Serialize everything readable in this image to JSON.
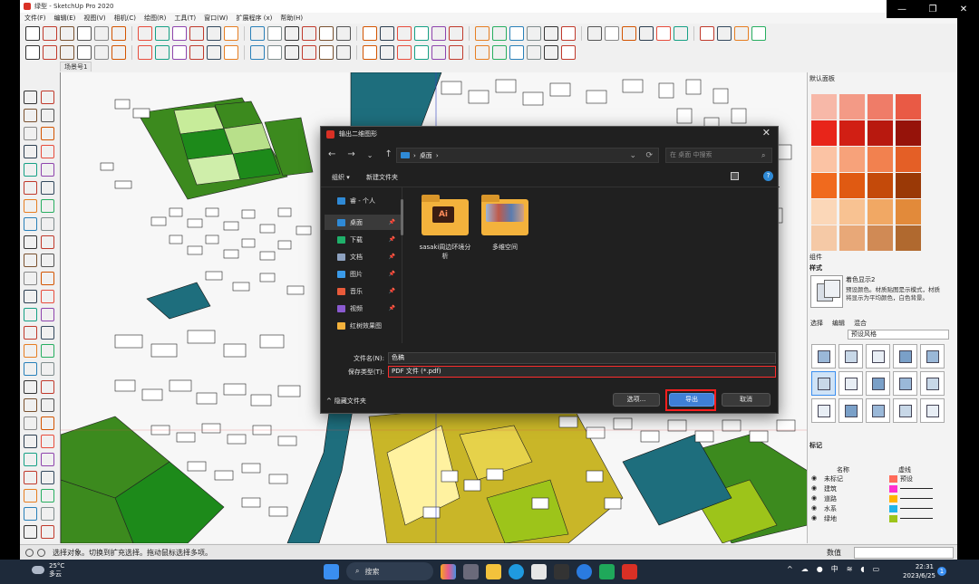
{
  "app": {
    "title": "绿型 - SketchUp Pro 2020",
    "scene_tab": "场景号1",
    "window_controls": [
      "minimize-icon",
      "maximize-icon",
      "close-icon"
    ]
  },
  "menu": [
    "文件(F)",
    "编辑(E)",
    "视图(V)",
    "相机(C)",
    "绘图(R)",
    "工具(T)",
    "窗口(W)",
    "扩展程序 (x)",
    "帮助(H)"
  ],
  "status": {
    "text": "选择对象。切换到扩充选择。拖动鼠标选择多项。",
    "value_label": "数值"
  },
  "right_panel": {
    "tray_title": "默认面板",
    "components_label": "组件",
    "styles_label": "样式",
    "style_name": "着色显示2",
    "style_desc": "预设颜色。材质贴图是示模式，材质将显示为平均颜色，白色背景。",
    "style_tabs": [
      "选择",
      "编辑",
      "混合"
    ],
    "style_dropdown": "预设风格",
    "tags_label": "标记",
    "tags_header": [
      "名称",
      "虚线"
    ],
    "tags": [
      {
        "name": "未标记",
        "color": "#ff6a5a",
        "dash": "预设"
      },
      {
        "name": "建筑",
        "color": "#ff2fd0",
        "dash": ""
      },
      {
        "name": "道路",
        "color": "#ffb400",
        "dash": ""
      },
      {
        "name": "水系",
        "color": "#1fb4e8",
        "dash": ""
      },
      {
        "name": "绿地",
        "color": "#9dc41a",
        "dash": ""
      }
    ],
    "swatch_colors": [
      "#f7b8a8",
      "#f39a86",
      "#ef7c68",
      "#e95a45",
      "#e8251a",
      "#d11f14",
      "#b8190f",
      "#96130a",
      "#fbc3a4",
      "#f7a27a",
      "#f2814f",
      "#e45f26",
      "#f06a1e",
      "#e05a12",
      "#c44a0a",
      "#9a3906",
      "#fbd7b8",
      "#f8c292",
      "#f1a864",
      "#e28a3a",
      "#f5c9a6",
      "#e8a878",
      "#d08a55",
      "#b0692f"
    ]
  },
  "dialog": {
    "title": "输出二维图形",
    "breadcrumb_sep": "›",
    "location": "桌面",
    "search_placeholder": "在 桌面 中搜索",
    "organize": "组织 ▾",
    "new_folder": "新建文件夹",
    "nav": [
      {
        "label": "睿 - 个人",
        "color": "#2f8ad6",
        "pinned": false
      },
      {
        "label": "桌面",
        "color": "#2f8ad6",
        "pinned": true
      },
      {
        "label": "下载",
        "color": "#1fb06a",
        "pinned": true
      },
      {
        "label": "文档",
        "color": "#8ea2c0",
        "pinned": true
      },
      {
        "label": "图片",
        "color": "#3a9ae8",
        "pinned": true
      },
      {
        "label": "音乐",
        "color": "#e85a3a",
        "pinned": true
      },
      {
        "label": "视频",
        "color": "#8a5ad0",
        "pinned": true
      },
      {
        "label": "红树效果图",
        "color": "#f3b23c",
        "pinned": false
      }
    ],
    "files": [
      {
        "name": "sasaki周边环境分析",
        "badge": "Ai"
      },
      {
        "name": "多维空间",
        "badge": ""
      }
    ],
    "filename_label": "文件名(N):",
    "filename_value": "色稿",
    "filetype_label": "保存类型(T):",
    "filetype_value": "PDF 文件 (*.pdf)",
    "hide_folders": "隐藏文件夹",
    "options_button": "选项...",
    "export_button": "导出",
    "cancel_button": "取消",
    "pin_glyph": "📌"
  },
  "taskbar": {
    "temp": "25°C",
    "weather": "多云",
    "search": "搜索",
    "ime": "中",
    "time": "22:31",
    "date": "2023/6/25",
    "notifications": "1"
  }
}
